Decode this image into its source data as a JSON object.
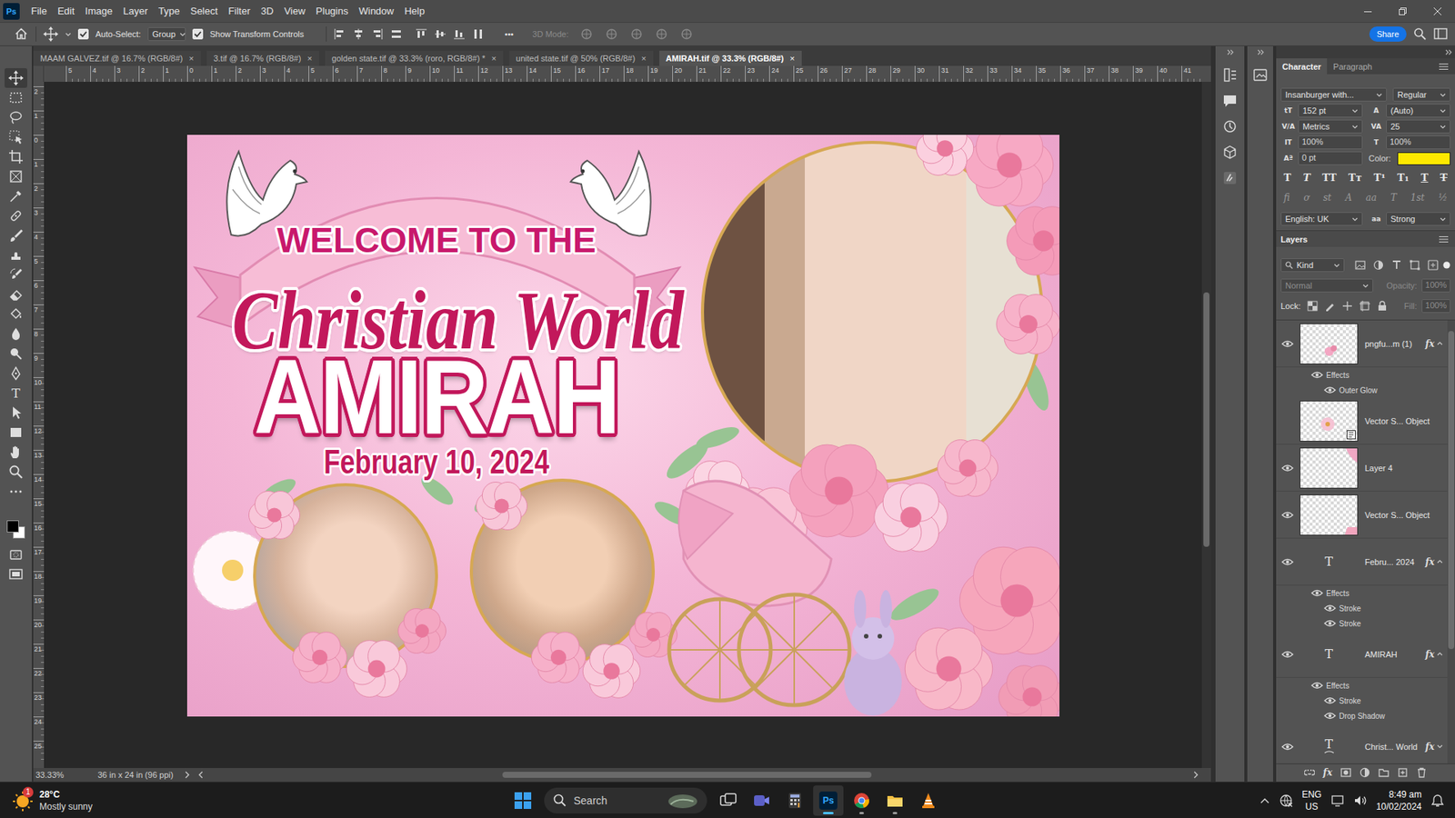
{
  "app": {
    "logo": "Ps"
  },
  "menu": [
    "File",
    "Edit",
    "Image",
    "Layer",
    "Type",
    "Select",
    "Filter",
    "3D",
    "View",
    "Plugins",
    "Window",
    "Help"
  ],
  "options_bar": {
    "auto_select": {
      "label": "Auto-Select:",
      "checked": true
    },
    "group": "Group",
    "show_transform": {
      "label": "Show Transform Controls",
      "checked": true
    },
    "more": "•••",
    "mode_3d": {
      "label": "3D Mode:",
      "disabled": true
    },
    "share": "Share"
  },
  "doc_tabs": [
    {
      "label": "MAAM GALVEZ.tif @ 16.7% (RGB/8#)",
      "close": "×",
      "selected": false
    },
    {
      "label": "3.tif @ 16.7% (RGB/8#)",
      "close": "×",
      "selected": false
    },
    {
      "label": "golden state.tif @ 33.3% (roro, RGB/8#) *",
      "close": "×",
      "selected": false
    },
    {
      "label": "united state.tif @ 50% (RGB/8#)",
      "close": "×",
      "selected": false
    },
    {
      "label": "AMIRAH.tif @ 33.3% (RGB/8#)",
      "close": "×",
      "selected": true
    }
  ],
  "rulers": {
    "top": [
      "5",
      "4",
      "3",
      "2",
      "1",
      "0",
      "1",
      "2",
      "3",
      "4",
      "5",
      "6",
      "7",
      "8",
      "9",
      "10",
      "11",
      "12",
      "13",
      "14",
      "15",
      "16",
      "17",
      "18",
      "19",
      "20",
      "21",
      "22",
      "23",
      "24",
      "25",
      "26",
      "27",
      "28",
      "29",
      "30",
      "31",
      "32",
      "33",
      "34",
      "35",
      "36",
      "37",
      "38",
      "39",
      "40",
      "41"
    ],
    "left": [
      "2",
      "1",
      "0",
      "1",
      "2",
      "3",
      "4",
      "5",
      "6",
      "7",
      "8",
      "9",
      "10",
      "11",
      "12",
      "13",
      "14",
      "15",
      "16",
      "17",
      "18",
      "19",
      "20",
      "21",
      "22",
      "23",
      "24",
      "25"
    ]
  },
  "tools": [
    {
      "kind": "move",
      "selected": true
    },
    {
      "kind": "marquee",
      "selected": false
    },
    {
      "kind": "lasso",
      "selected": false
    },
    {
      "kind": "object-select",
      "selected": false
    },
    {
      "kind": "crop",
      "selected": false
    },
    {
      "kind": "frame",
      "selected": false
    },
    {
      "kind": "eyedropper",
      "selected": false
    },
    {
      "kind": "healing",
      "selected": false
    },
    {
      "kind": "brush",
      "selected": false
    },
    {
      "kind": "stamp",
      "selected": false
    },
    {
      "kind": "history-brush",
      "selected": false
    },
    {
      "kind": "eraser",
      "selected": false
    },
    {
      "kind": "bucket",
      "selected": false
    },
    {
      "kind": "blur",
      "selected": false
    },
    {
      "kind": "dodge",
      "selected": false
    },
    {
      "kind": "pen",
      "selected": false
    },
    {
      "kind": "type",
      "glyph": "T",
      "selected": false
    },
    {
      "kind": "path-select",
      "selected": false
    },
    {
      "kind": "shape",
      "selected": false
    },
    {
      "kind": "hand",
      "selected": false
    },
    {
      "kind": "zoom",
      "selected": false
    },
    {
      "kind": "more",
      "selected": false
    }
  ],
  "colors": {
    "foreground": "#000000",
    "background": "#ffffff"
  },
  "document": {
    "welcome": "WELCOME TO THE",
    "script": "Christian World",
    "name": "AMIRAH",
    "date": "February 10, 2024"
  },
  "status_bar": {
    "zoom": "33.33%",
    "doc_info": "36 in x 24 in (96 ppi)"
  },
  "panel_tabs": [
    {
      "label": "Character",
      "selected": true
    },
    {
      "label": "Paragraph",
      "selected": false
    }
  ],
  "character": {
    "font": "Insanburger with...",
    "style": "Regular",
    "fields": [
      [
        {
          "kind": "field",
          "icon": "tT",
          "value": "152 pt",
          "dropdown": true
        },
        {
          "kind": "field",
          "icon": "A",
          "value": "(Auto)",
          "dropdown": true
        }
      ],
      [
        {
          "kind": "field",
          "icon": "V/A",
          "value": "Metrics",
          "dropdown": true
        },
        {
          "kind": "field",
          "icon": "VA",
          "value": "25",
          "dropdown": true
        }
      ],
      [
        {
          "kind": "field",
          "icon": "IT",
          "value": "100%",
          "dropdown": false
        },
        {
          "kind": "field",
          "icon": "T",
          "value": "100%",
          "dropdown": false
        }
      ],
      [
        {
          "kind": "field",
          "icon": "Aª",
          "value": "0 pt",
          "dropdown": false
        },
        {
          "kind": "color",
          "label": "Color:",
          "color": "#fde800"
        }
      ]
    ],
    "styles": [
      {
        "glyph": "T",
        "kind": "bold"
      },
      {
        "glyph": "T",
        "kind": "italic"
      },
      {
        "glyph": "TT",
        "kind": "caps"
      },
      {
        "glyph": "Tᴛ",
        "kind": "small-caps"
      },
      {
        "glyph": "T¹",
        "kind": "super"
      },
      {
        "glyph": "T₁",
        "kind": "sub"
      },
      {
        "glyph": "T",
        "kind": "underline"
      },
      {
        "glyph": "T",
        "kind": "strike"
      }
    ],
    "opentype": [
      "fi",
      "ơ",
      "st",
      "A",
      "aa",
      "T",
      "1st",
      "½"
    ],
    "language": "English: UK",
    "aa_icon": "aa",
    "antialias": "Strong"
  },
  "layers": {
    "title": "Layers",
    "filter": "Kind",
    "blend": {
      "value": "Normal",
      "disabled": true
    },
    "opacity": {
      "label": "Opacity:",
      "value": "100%",
      "disabled": true
    },
    "lock_label": "Lock:",
    "fill": {
      "label": "Fill:",
      "value": "100%",
      "disabled": true
    },
    "items": [
      {
        "name": "pngfu...m (1)",
        "kind": "pixel",
        "visible": true,
        "selected": false,
        "fx": "fx",
        "expanded": true,
        "effects_label": "Effects",
        "effects_visible": true,
        "effects": [
          {
            "label": "Outer Glow",
            "visible": true
          }
        ]
      },
      {
        "name": "Vector S... Object",
        "kind": "smart",
        "visible": false,
        "selected": false
      },
      {
        "name": "Layer 4",
        "kind": "pixel",
        "visible": true,
        "selected": false
      },
      {
        "name": "Vector S... Object",
        "kind": "pixel",
        "visible": true,
        "selected": false
      },
      {
        "name": "Febru... 2024",
        "kind": "text",
        "glyph": "T",
        "visible": true,
        "selected": false,
        "fx": "fx",
        "expanded": true,
        "effects_label": "Effects",
        "effects_visible": true,
        "effects": [
          {
            "label": "Stroke",
            "visible": true
          },
          {
            "label": "Stroke",
            "visible": true
          }
        ]
      },
      {
        "name": "AMIRAH",
        "kind": "text",
        "glyph": "T",
        "visible": true,
        "selected": false,
        "fx": "fx",
        "expanded": true,
        "effects_label": "Effects",
        "effects_visible": true,
        "effects": [
          {
            "label": "Stroke",
            "visible": true
          },
          {
            "label": "Drop Shadow",
            "visible": true
          }
        ]
      },
      {
        "name": "Christ... World",
        "kind": "warped-text",
        "glyph": "T",
        "visible": true,
        "selected": false,
        "fx": "fx",
        "expanded": false
      }
    ],
    "footer_fx": "fx"
  },
  "taskbar": {
    "weather": {
      "temp": "28°C",
      "desc": "Mostly sunny",
      "badge": "1"
    },
    "search": "Search",
    "apps": [
      {
        "kind": "task-view",
        "running": false,
        "active": false
      },
      {
        "kind": "meet",
        "running": false,
        "active": false
      },
      {
        "kind": "calculator",
        "running": false,
        "active": false
      },
      {
        "kind": "photoshop",
        "label": "Ps",
        "running": true,
        "active": true
      },
      {
        "kind": "chrome",
        "running": true,
        "active": false
      },
      {
        "kind": "explorer",
        "running": true,
        "active": false
      },
      {
        "kind": "vlc",
        "running": false,
        "active": false
      }
    ],
    "tray": {
      "lang": "ENG",
      "region": "US",
      "time": "8:49 am",
      "date": "10/02/2024"
    }
  }
}
